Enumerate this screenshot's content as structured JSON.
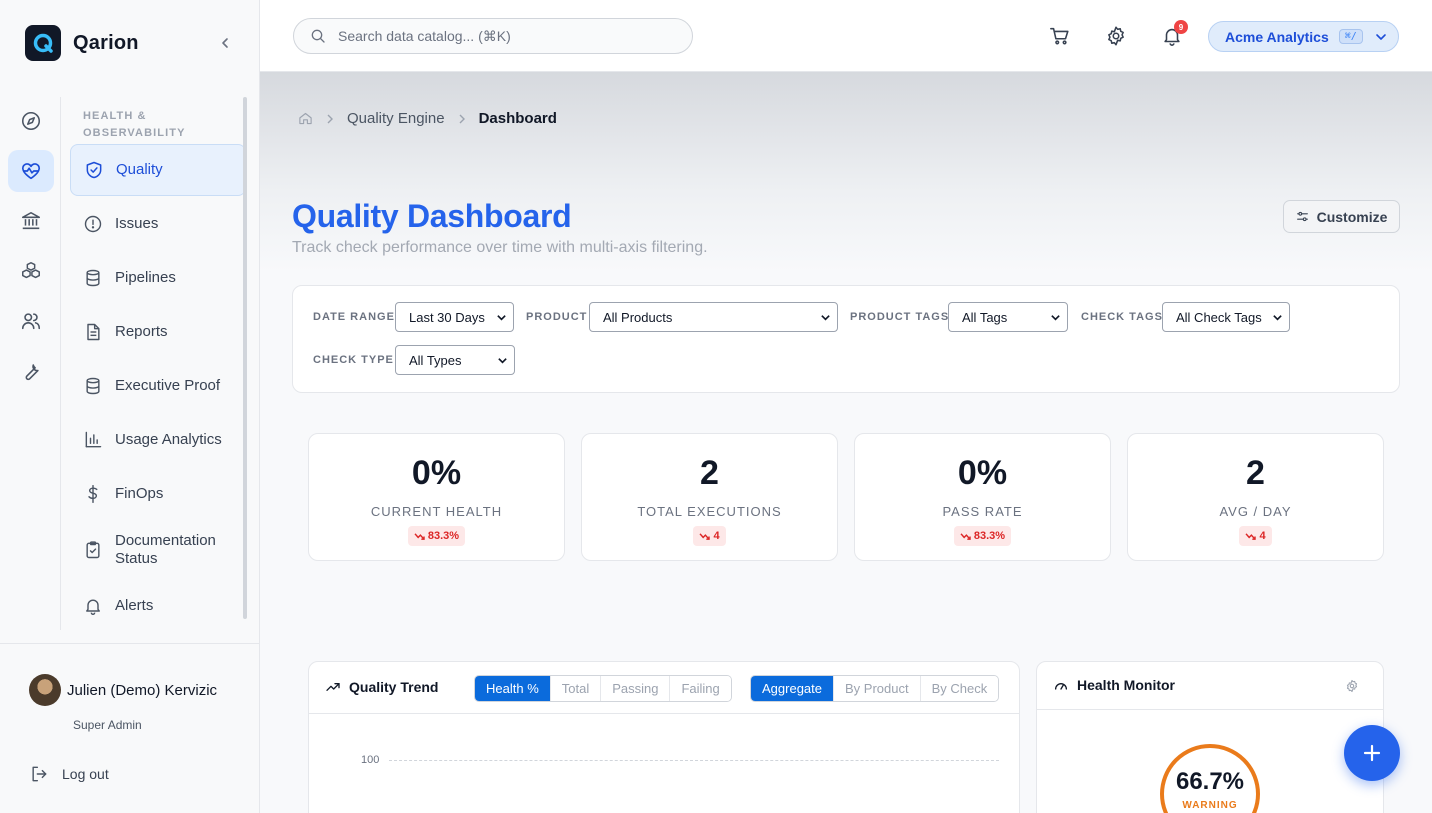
{
  "brand": {
    "name": "Qarion"
  },
  "sidebar": {
    "section_label": "HEALTH & OBSERVABILITY",
    "items": [
      {
        "label": "Quality",
        "icon": "shield-check-icon"
      },
      {
        "label": "Issues",
        "icon": "alert-circle-icon"
      },
      {
        "label": "Pipelines",
        "icon": "database-icon"
      },
      {
        "label": "Reports",
        "icon": "document-icon"
      },
      {
        "label": "Executive Proof",
        "icon": "database-icon"
      },
      {
        "label": "Usage Analytics",
        "icon": "bar-chart-icon"
      },
      {
        "label": "FinOps",
        "icon": "dollar-icon"
      },
      {
        "label": "Documentation Status",
        "icon": "clipboard-check-icon"
      },
      {
        "label": "Alerts",
        "icon": "bell-icon"
      }
    ],
    "rail_icons": [
      "compass-icon",
      "heart-pulse-icon",
      "bank-icon",
      "cubes-icon",
      "users-icon",
      "wrench-icon"
    ],
    "user": {
      "name": "Julien (Demo) Kervizic",
      "role": "Super Admin"
    },
    "logout_label": "Log out"
  },
  "topbar": {
    "search_placeholder": "Search data catalog... (⌘K)",
    "notification_count": "9",
    "org": {
      "name": "Acme Analytics",
      "shortcut": "⌘/"
    }
  },
  "breadcrumb": {
    "parent": "Quality Engine",
    "current": "Dashboard"
  },
  "page": {
    "title": "Quality Dashboard",
    "subtitle": "Track check performance over time with multi-axis filtering.",
    "customize_label": "Customize"
  },
  "filters": {
    "date_range": {
      "label": "DATE RANGE",
      "value": "Last 30 Days"
    },
    "product": {
      "label": "PRODUCT",
      "value": "All Products"
    },
    "product_tags": {
      "label": "PRODUCT TAGS",
      "value": "All Tags"
    },
    "check_tags": {
      "label": "CHECK TAGS",
      "value": "All Check Tags"
    },
    "check_type": {
      "label": "CHECK TYPE",
      "value": "All Types"
    }
  },
  "kpis": [
    {
      "value": "0%",
      "label": "CURRENT HEALTH",
      "delta": "83.3%"
    },
    {
      "value": "2",
      "label": "TOTAL EXECUTIONS",
      "delta": "4"
    },
    {
      "value": "0%",
      "label": "PASS RATE",
      "delta": "83.3%"
    },
    {
      "value": "2",
      "label": "AVG / DAY",
      "delta": "4"
    }
  ],
  "trend": {
    "title": "Quality Trend",
    "metric_tabs": [
      "Health %",
      "Total",
      "Passing",
      "Failing"
    ],
    "metric_active": "Health %",
    "group_tabs": [
      "Aggregate",
      "By Product",
      "By Check"
    ],
    "group_active": "Aggregate",
    "y_tick_top": "100"
  },
  "health_monitor": {
    "title": "Health Monitor",
    "value": "66.7%",
    "status": "WARNING"
  },
  "colors": {
    "accent": "#2563eb",
    "warning": "#ea7b1b",
    "negative": "#dc2626"
  }
}
